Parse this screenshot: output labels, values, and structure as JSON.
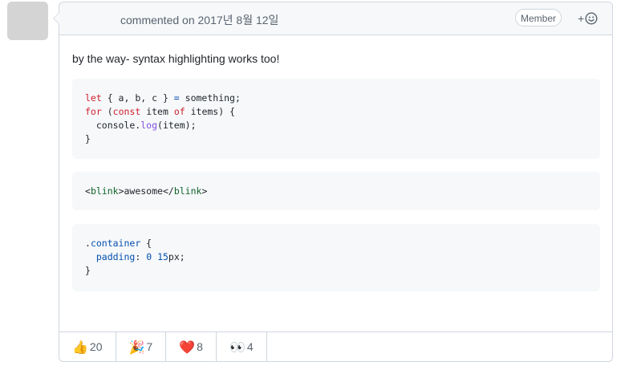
{
  "header": {
    "timestamp": "commented on 2017년 8월 12일",
    "role_badge": "Member",
    "add_reaction": "+"
  },
  "body": {
    "intro": "by the way- syntax highlighting works too!"
  },
  "code_blocks": {
    "js": {
      "l1_kw": "let",
      "l1_rest_a": " { a, b, c } ",
      "l1_op": "=",
      "l1_rest_b": " something;",
      "l2_kw1": "for",
      "l2_p": " (",
      "l2_kw2": "const",
      "l2_mid": " item ",
      "l2_kw3": "of",
      "l2_end": " items) {",
      "l3_a": "  console.",
      "l3_fn": "log",
      "l3_b": "(item);",
      "l4": "}"
    },
    "html": {
      "open_lt": "<",
      "open_tag": "blink",
      "open_gt": ">awesome</",
      "close_tag": "blink",
      "close_gt": ">"
    },
    "css": {
      "l1_dot": ".",
      "l1_cls": "container",
      "l1_brace": " {",
      "l2_indent": "  ",
      "l2_prop": "padding",
      "l2_colon": ": ",
      "l2_n1": "0",
      "l2_sp": " ",
      "l2_n2": "15",
      "l2_unit": "px;",
      "l3": "}"
    }
  },
  "reactions": [
    {
      "emoji": "👍",
      "icon": "thumbs-up-icon",
      "count": "20"
    },
    {
      "emoji": "🎉",
      "icon": "party-popper-icon",
      "count": "7"
    },
    {
      "emoji": "❤️",
      "icon": "heart-icon",
      "count": "8"
    },
    {
      "emoji": "👀",
      "icon": "eyes-icon",
      "count": "4"
    }
  ]
}
